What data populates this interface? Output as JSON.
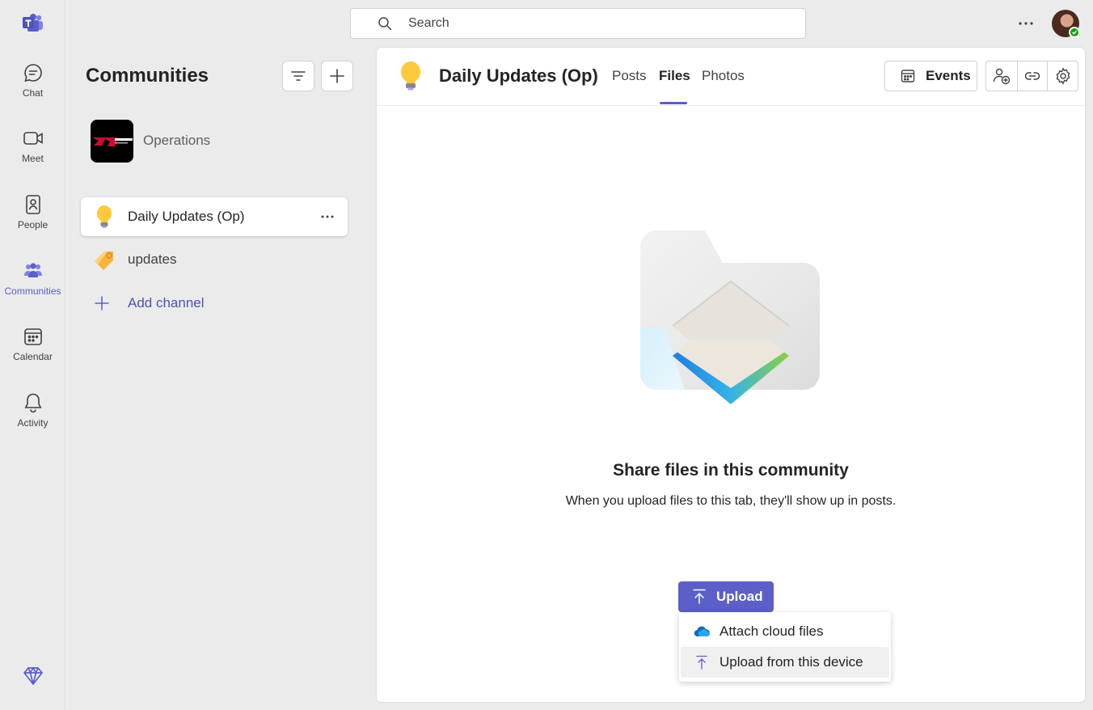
{
  "search": {
    "placeholder": "Search"
  },
  "rail": {
    "items": [
      {
        "label": "Chat",
        "icon": "chat-icon"
      },
      {
        "label": "Meet",
        "icon": "video-icon"
      },
      {
        "label": "People",
        "icon": "people-icon"
      },
      {
        "label": "Communities",
        "icon": "communities-icon",
        "active": true
      },
      {
        "label": "Calendar",
        "icon": "calendar-icon"
      },
      {
        "label": "Activity",
        "icon": "bell-icon"
      }
    ]
  },
  "panel": {
    "title": "Communities",
    "org_name": "Operations",
    "channels": [
      {
        "name": "Daily Updates (Op)",
        "icon": "lightbulb-icon",
        "selected": true
      },
      {
        "name": "updates",
        "icon": "tag-icon"
      }
    ],
    "add_channel": "Add channel"
  },
  "main": {
    "title": "Daily Updates (Op)",
    "tabs": [
      "Posts",
      "Files",
      "Photos"
    ],
    "active_tab": "Files",
    "events_label": "Events",
    "empty_title": "Share files in this community",
    "empty_subtitle": "When you upload files to this tab, they'll show up in posts.",
    "upload_label": "Upload",
    "menu": [
      {
        "label": "Attach cloud files",
        "icon": "onedrive-cloud-icon"
      },
      {
        "label": "Upload from this device",
        "icon": "upload-arrow-icon"
      }
    ]
  },
  "colors": {
    "accent": "#5b5fc7",
    "presence": "#13a10e"
  }
}
